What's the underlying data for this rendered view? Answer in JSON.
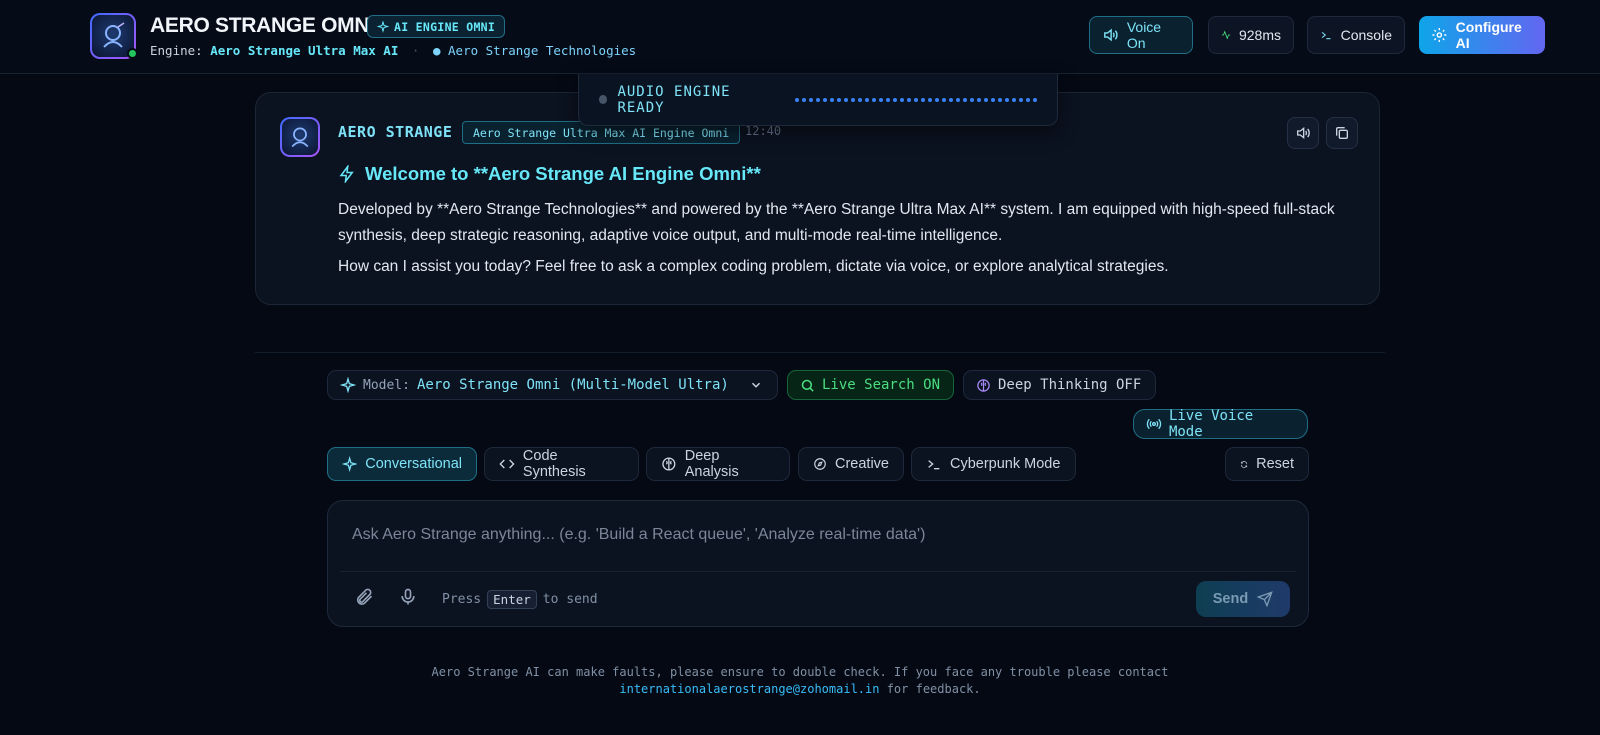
{
  "header": {
    "app_title": "AERO STRANGE OMNI",
    "title_badge": "AI ENGINE OMNI",
    "engine_label": "Engine:",
    "engine_name": "Aero Strange Ultra Max AI",
    "separator": "·",
    "company": "Aero Strange Technologies",
    "buttons": {
      "voice": "Voice On",
      "latency": "928ms",
      "console": "Console",
      "configure": "Configure AI"
    }
  },
  "toast": {
    "text": "AUDIO ENGINE READY"
  },
  "message": {
    "sender": "AERO STRANGE",
    "model_tag": "Aero Strange Ultra Max AI Engine Omni",
    "time": "12:40",
    "heading": "Welcome to **Aero Strange AI Engine Omni**",
    "paragraph1": "Developed by **Aero Strange Technologies** and powered by the **Aero Strange Ultra Max AI** system. I am equipped with high-speed full-stack synthesis, deep strategic reasoning, adaptive voice output, and multi-mode real-time intelligence.",
    "paragraph2": "How can I assist you today? Feel free to ask a complex coding problem, dictate via voice, or explore analytical strategies."
  },
  "controls": {
    "model_label": "Model:",
    "model_value": "Aero Strange Omni (Multi-Model Ultra)",
    "live_search": "Live Search ON",
    "deep_thinking": "Deep Thinking OFF",
    "live_voice": "Live Voice Mode"
  },
  "modes": {
    "conversational": "Conversational",
    "code": "Code Synthesis",
    "analysis": "Deep Analysis",
    "creative": "Creative",
    "cyberpunk": "Cyberpunk Mode",
    "reset": "Reset"
  },
  "composer": {
    "placeholder": "Ask Aero Strange anything... (e.g. 'Build a React queue', 'Analyze real-time data')",
    "value": "",
    "hint_press": "Press",
    "hint_key": "Enter",
    "hint_suffix": "to send",
    "send_label": "Send"
  },
  "footer": {
    "line1": "Aero Strange AI can make faults, please ensure to double check. If you face any trouble please contact",
    "email": "internationalaerostrange@zohomail.in",
    "line2_suffix": "for feedback."
  },
  "colors": {
    "background": "#040914",
    "accent": "#67e8f9",
    "success": "#4ade80",
    "brand_gradient_start": "#0ea5e9",
    "brand_gradient_end": "#6366f1"
  }
}
